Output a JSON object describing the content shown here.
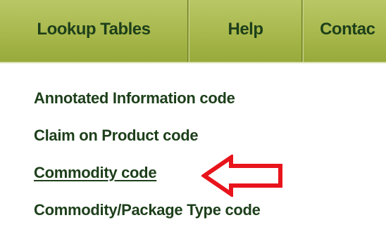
{
  "navbar": {
    "items": [
      {
        "label": "Lookup Tables"
      },
      {
        "label": "Help"
      },
      {
        "label": "Contac"
      }
    ]
  },
  "dropdown": {
    "items": [
      {
        "label": "Annotated Information code"
      },
      {
        "label": "Claim on Product code"
      },
      {
        "label": "Commodity code",
        "active": true
      },
      {
        "label": "Commodity/Package Type code"
      }
    ]
  },
  "colors": {
    "nav_background": "#a8b84c",
    "text": "#1d3f1a",
    "arrow": "#e8141c"
  },
  "icons": {
    "annotation_arrow": "red-left-arrow-outline"
  }
}
